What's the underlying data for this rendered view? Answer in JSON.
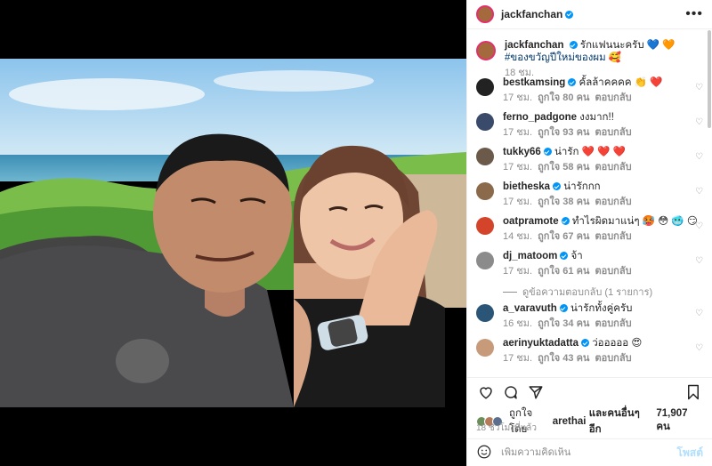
{
  "post": {
    "author": "jackfanchan",
    "caption_author": "jackfanchan",
    "caption_line1": "รักแฟนนะครับ 💙 🧡",
    "caption_line2": "#ของขวัญปีใหม่ของผม 🥰",
    "caption_time": "18 ชม.",
    "more_icon": "•••"
  },
  "comments": [
    {
      "user": "bestkamsing",
      "verified": true,
      "text": "คั้ลล้าคคคค 👏 ❤️",
      "time": "17 ชม.",
      "likes": "ถูกใจ 80 คน",
      "reply": "ตอบกลับ",
      "avatar_color": "#222"
    },
    {
      "user": "ferno_padgone",
      "verified": false,
      "text": "งงมาก!!",
      "time": "17 ชม.",
      "likes": "ถูกใจ 93 คน",
      "reply": "ตอบกลับ",
      "avatar_color": "#3a4a6b"
    },
    {
      "user": "tukky66",
      "verified": true,
      "text": "น่ารัก ❤️ ❤️ ❤️",
      "time": "17 ชม.",
      "likes": "ถูกใจ 58 คน",
      "reply": "ตอบกลับ",
      "avatar_color": "#6b5a4a"
    },
    {
      "user": "bietheska",
      "verified": true,
      "text": "น่ารักกก",
      "time": "17 ชม.",
      "likes": "ถูกใจ 38 คน",
      "reply": "ตอบกลับ",
      "avatar_color": "#8a6a4a"
    },
    {
      "user": "oatpramote",
      "verified": true,
      "text": "ทำไรผิดมาแน่ๆ 🥵 😳 🥶 😏",
      "time": "14 ชม.",
      "likes": "ถูกใจ 67 คน",
      "reply": "ตอบกลับ",
      "avatar_color": "#d4442a"
    },
    {
      "user": "dj_matoom",
      "verified": true,
      "text": "จ้า",
      "time": "17 ชม.",
      "likes": "ถูกใจ 61 คน",
      "reply": "ตอบกลับ",
      "avatar_color": "#8b8b8b"
    },
    {
      "user": "a_varavuth",
      "verified": true,
      "text": "น่ารักทั้งคู่ครับ",
      "time": "16 ชม.",
      "likes": "ถูกใจ 34 คน",
      "reply": "ตอบกลับ",
      "avatar_color": "#2b5577"
    },
    {
      "user": "aerinyuktadatta",
      "verified": true,
      "text": "ว่อออออ 😍",
      "time": "17 ชม.",
      "likes": "ถูกใจ 43 คน",
      "reply": "ตอบกลับ",
      "avatar_color": "#c79a7a"
    }
  ],
  "view_replies": "ดูข้อความตอบกลับ (1 รายการ)",
  "liked_by": {
    "prefix": "ถูกใจโดย",
    "user": "arethai",
    "middle": "และคนอื่นๆ อีก",
    "count": "71,907 คน"
  },
  "timestamp": "18 ชั่วโมงที่แล้ว",
  "add_comment": {
    "placeholder": "เพิ่มความคิดเห็น",
    "post_label": "โพสต์"
  },
  "colors": {
    "accent": "#0095f6",
    "heart": "#ed4956"
  }
}
